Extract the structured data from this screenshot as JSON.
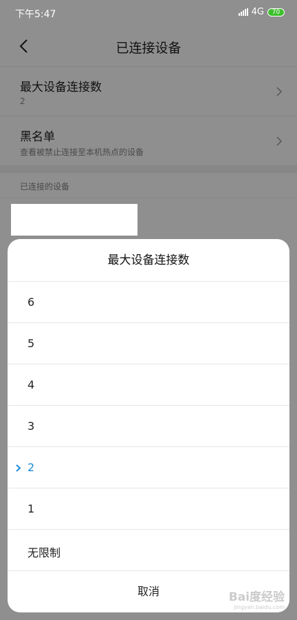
{
  "status_bar": {
    "time": "下午5:47",
    "network": "4G",
    "battery": "70"
  },
  "header": {
    "title": "已连接设备"
  },
  "settings": {
    "items": [
      {
        "title": "最大设备连接数",
        "subtitle": "2"
      },
      {
        "title": "黑名单",
        "subtitle": "查看被禁止连接至本机热点的设备"
      }
    ],
    "connected_header": "已连接的设备"
  },
  "dialog": {
    "title": "最大设备连接数",
    "options": [
      "6",
      "5",
      "4",
      "3",
      "2",
      "1",
      "无限制"
    ],
    "selected": "2",
    "cancel_label": "取消"
  },
  "watermark": {
    "text": "Bai度经验",
    "url": "jingyan.baidu.com"
  },
  "colors": {
    "accent": "#1a8ad8",
    "battery": "#3fbf2e"
  }
}
